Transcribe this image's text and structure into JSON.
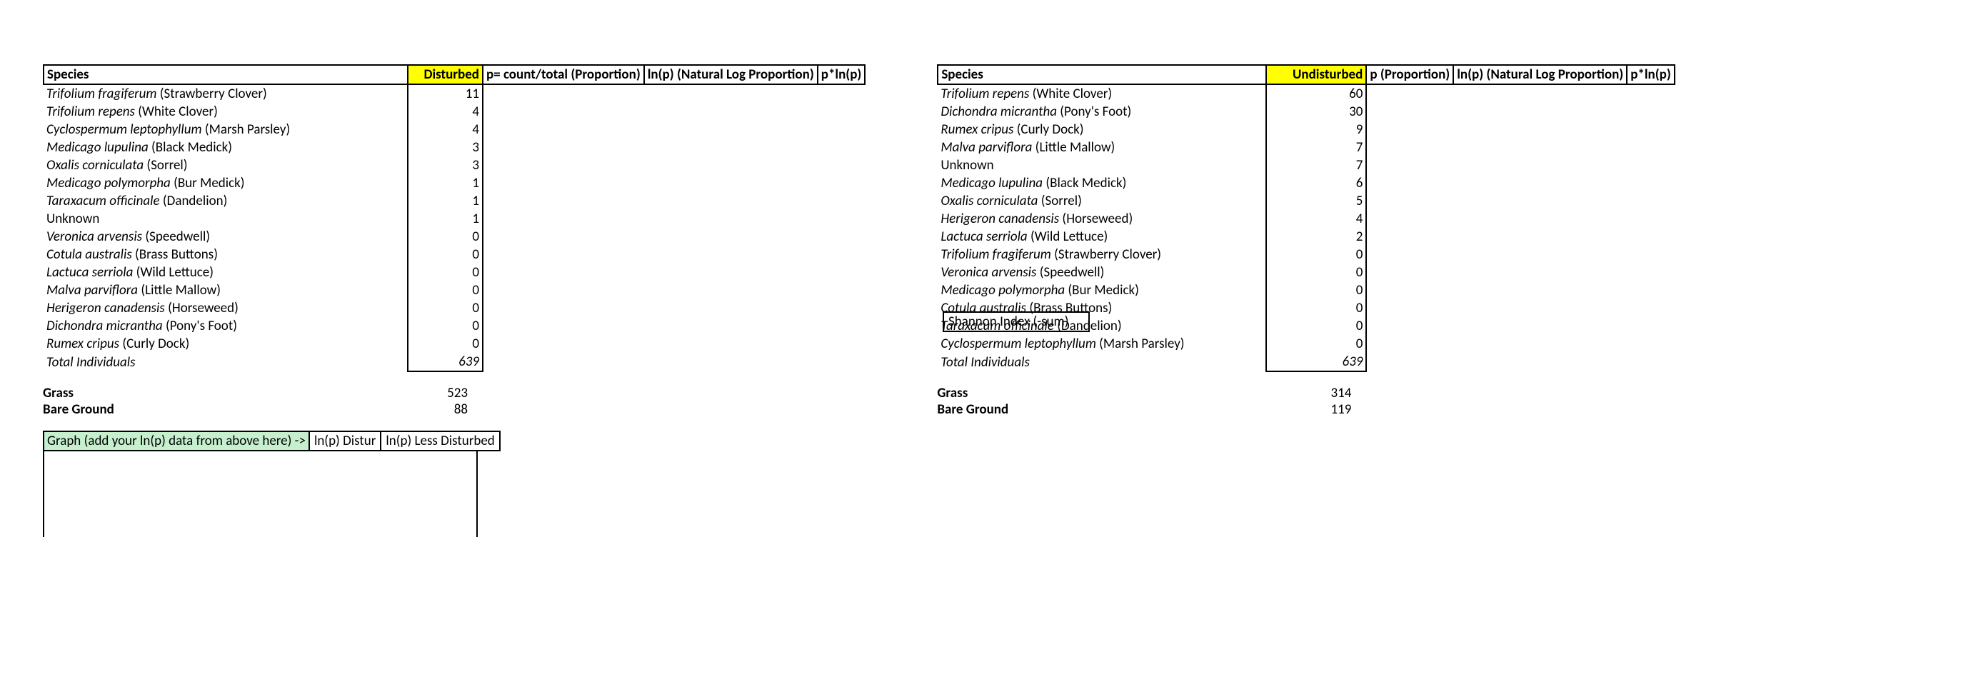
{
  "left": {
    "headers": [
      "Species",
      "Disturbed",
      "p= count/total (Proportion)",
      "ln(p) (Natural Log Proportion)",
      "p*ln(p)"
    ],
    "rows": [
      {
        "latin": "Trifolium fragiferum",
        "common": " (Strawberry Clover)",
        "count": 11
      },
      {
        "latin": "Trifolium repens",
        "common": " (White Clover)",
        "count": 4
      },
      {
        "latin": "Cyclospermum leptophyllum",
        "common": " (Marsh Parsley)",
        "count": 4
      },
      {
        "latin": "Medicago lupulina",
        "common": " (Black Medick)",
        "count": 3
      },
      {
        "latin": "Oxalis corniculata",
        "common": " (Sorrel)",
        "count": 3
      },
      {
        "latin": "Medicago polymorpha",
        "common": " (Bur Medick)",
        "count": 1
      },
      {
        "latin": "Taraxacum officinale",
        "common": " (Dandelion)",
        "count": 1
      },
      {
        "latin": "",
        "common": "Unknown",
        "count": 1
      },
      {
        "latin": "Veronica arvensis",
        "common": " (Speedwell)",
        "count": 0
      },
      {
        "latin": "Cotula australis",
        "common": " (Brass Buttons)",
        "count": 0
      },
      {
        "latin": "Lactuca serriola",
        "common": " (Wild Lettuce)",
        "count": 0
      },
      {
        "latin": "Malva parviflora",
        "common": " (Little Mallow)",
        "count": 0
      },
      {
        "latin": "Herigeron canadensis",
        "common": " (Horseweed)",
        "count": 0
      },
      {
        "latin": "Dichondra micrantha",
        "common": " (Pony's Foot)",
        "count": 0
      },
      {
        "latin": "Rumex cripus",
        "common": " (Curly Dock)",
        "count": 0
      }
    ],
    "total_label": "Total Individuals",
    "total": 639,
    "extras": [
      {
        "label": "Grass",
        "value": 523
      },
      {
        "label": "Bare Ground",
        "value": 88
      }
    ],
    "shannon_label": "Shannon Index (-sum)"
  },
  "right": {
    "headers": [
      "Species",
      "Undisturbed",
      "p (Proportion)",
      "ln(p) (Natural Log Proportion)",
      "p*ln(p)"
    ],
    "rows": [
      {
        "latin": "Trifolium repens",
        "common": " (White Clover)",
        "count": 60
      },
      {
        "latin": "Dichondra micrantha",
        "common": " (Pony's Foot)",
        "count": 30
      },
      {
        "latin": "Rumex cripus",
        "common": " (Curly Dock)",
        "count": 9
      },
      {
        "latin": "Malva parviflora",
        "common": " (Little Mallow)",
        "count": 7
      },
      {
        "latin": "",
        "common": "Unknown",
        "count": 7
      },
      {
        "latin": "Medicago lupulina",
        "common": " (Black Medick)",
        "count": 6
      },
      {
        "latin": "Oxalis corniculata",
        "common": " (Sorrel)",
        "count": 5
      },
      {
        "latin": "Herigeron canadensis",
        "common": " (Horseweed)",
        "count": 4
      },
      {
        "latin": "Lactuca serriola",
        "common": " (Wild Lettuce)",
        "count": 2
      },
      {
        "latin": "Trifolium fragiferum",
        "common": " (Strawberry Clover)",
        "count": 0
      },
      {
        "latin": "Veronica arvensis",
        "common": " (Speedwell)",
        "count": 0
      },
      {
        "latin": "Medicago polymorpha",
        "common": " (Bur Medick)",
        "count": 0
      },
      {
        "latin": "Cotula australis",
        "common": " (Brass Buttons)",
        "count": 0
      },
      {
        "latin": "Taraxacum officinale",
        "common": " (Dandelion)",
        "count": 0
      },
      {
        "latin": "Cyclospermum leptophyllum",
        "common": " (Marsh Parsley)",
        "count": 0
      }
    ],
    "total_label": "Total Individuals",
    "total": 639,
    "extras": [
      {
        "label": "Grass",
        "value": 314
      },
      {
        "label": "Bare Ground",
        "value": 119
      }
    ]
  },
  "graph": {
    "label": "Graph (add your ln(p) data from above here) ->",
    "col1": "ln(p) Distur",
    "col2": "ln(p) Less Disturbed"
  },
  "col_widths": {
    "left_species": "500px",
    "left_count": "95px",
    "right_species": "450px",
    "right_count": "130px"
  }
}
